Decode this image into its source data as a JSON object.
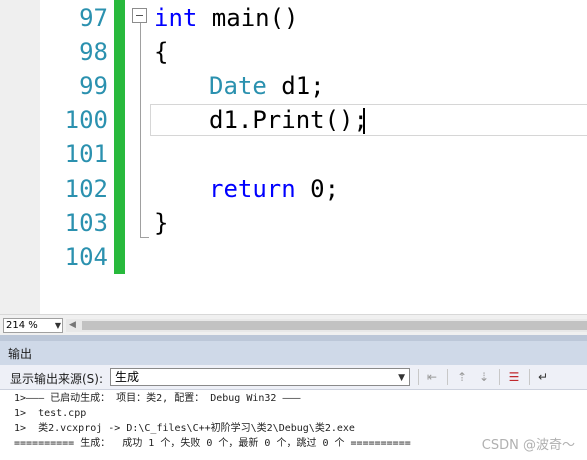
{
  "editor": {
    "line_numbers": [
      "97",
      "98",
      "99",
      "100",
      "101",
      "102",
      "103",
      "104"
    ],
    "code": {
      "line97_kw": "int",
      "line97_rest": " main()",
      "line98": "{",
      "line99_type": "Date",
      "line99_rest": " d1;",
      "line100": "d1.Print();",
      "line102_kw": "return",
      "line102_rest": " 0;",
      "line103": "}"
    },
    "colors": {
      "keyword": "#0000ff",
      "type": "#2b91af",
      "line_number": "#2b91af",
      "change_bar": "#28b93c"
    }
  },
  "zoom": {
    "value": "214 %"
  },
  "output": {
    "title": "输出",
    "source_label": "显示输出来源(S):",
    "source_value": "生成",
    "lines": [
      "1>——— 已启动生成： 项目：类2, 配置： Debug Win32 ———",
      "1>  test.cpp",
      "1>  类2.vcxproj -> D:\\C_files\\C++初阶学习\\类2\\Debug\\类2.exe",
      "========== 生成：  成功 1 个，失败 0 个，最新 0 个，跳过 0 个 =========="
    ]
  },
  "watermark": "CSDN @波奇～"
}
